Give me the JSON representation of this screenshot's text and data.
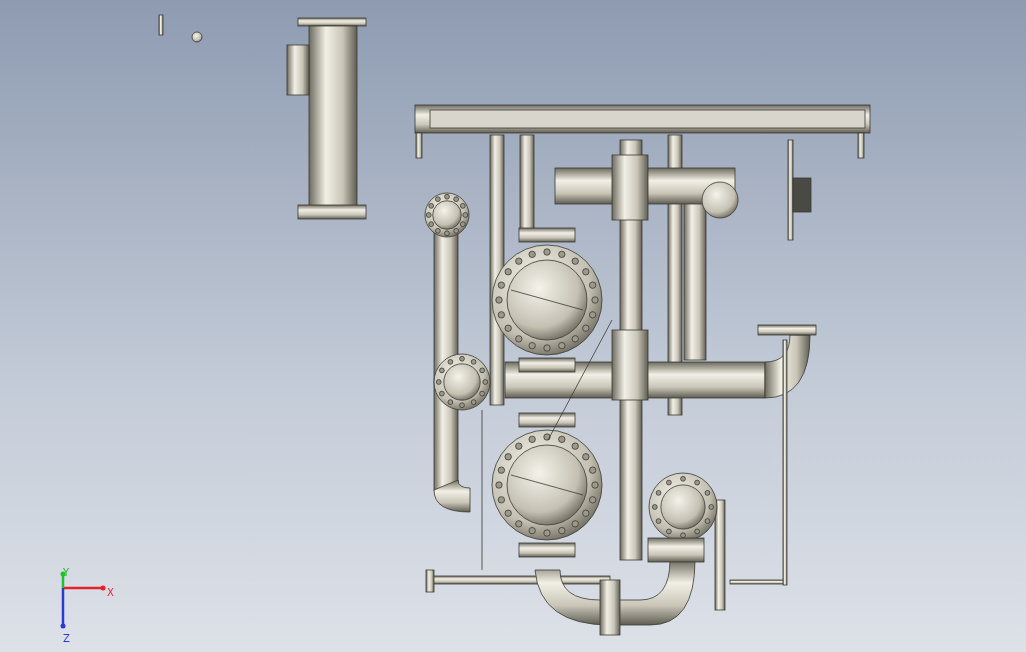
{
  "viewport": {
    "axes": [
      {
        "label": "X",
        "color": "#e8202a"
      },
      {
        "label": "Y",
        "color": "#22c02a"
      },
      {
        "label": "Z",
        "color": "#2a3ad0"
      }
    ]
  }
}
